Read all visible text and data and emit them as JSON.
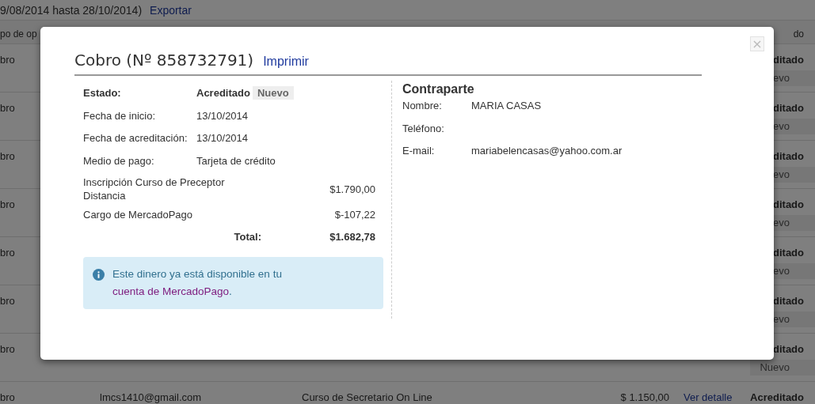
{
  "background": {
    "filter_text": "9/08/2014 hasta 28/10/2014)",
    "export_link": "Exportar",
    "header": {
      "column_1": "po de op",
      "column_6": "do"
    },
    "rows": [
      {
        "column_1": "bro",
        "status": "ditado",
        "badge": "evo"
      },
      {
        "column_1": "bro",
        "status": "ditado",
        "badge": "evo"
      },
      {
        "column_1": "bro",
        "status": "ditado",
        "badge": "evo"
      },
      {
        "column_1": "bro",
        "status": "ditado",
        "badge": "evo"
      },
      {
        "column_1": "bro",
        "status": "ditado",
        "badge": "evo"
      },
      {
        "column_1": "bro",
        "status": "ditado",
        "badge": "evo"
      },
      {
        "column_1": "bro",
        "status": "ditado",
        "badge": "Nuevo"
      },
      {
        "column_1": "bro",
        "email": "lmcs1410@gmail.com",
        "description": "Curso de Secretario On Line",
        "amount": "$ 1.150,00",
        "detail_link": "Ver detalle",
        "status": "Acreditado"
      }
    ]
  },
  "modal": {
    "title": "Cobro (Nº 858732791)",
    "print_link": "Imprimir",
    "close": "×",
    "details": [
      {
        "kind": "status",
        "label": "Estado:",
        "value": "Acreditado",
        "badge": "Nuevo"
      },
      {
        "kind": "plain",
        "label": "Fecha de inicio:",
        "value": "13/10/2014"
      },
      {
        "kind": "plain",
        "label": "Fecha de acreditación:",
        "value": "13/10/2014"
      },
      {
        "kind": "plain",
        "label": "Medio de pago:",
        "value": "Tarjeta de crédito"
      }
    ],
    "items": [
      {
        "description": "Inscripción Curso de Preceptor Distancia",
        "amount": "$1.790,00"
      },
      {
        "description": "Cargo de MercadoPago",
        "amount": "$-107,22"
      }
    ],
    "total": {
      "label": "Total:",
      "amount": "$1.682,78"
    },
    "alert": {
      "text": "Este dinero ya está disponible en tu ",
      "link": "cuenta de MercadoPago",
      "suffix": "."
    },
    "counterparty": {
      "heading": "Contraparte",
      "fields": [
        {
          "label": "Nombre:",
          "value": "MARIA CASAS"
        },
        {
          "label": "Teléfono:"
        },
        {
          "label": "E-mail:",
          "value": "mariabelencasas@yahoo.com.ar"
        }
      ]
    }
  }
}
